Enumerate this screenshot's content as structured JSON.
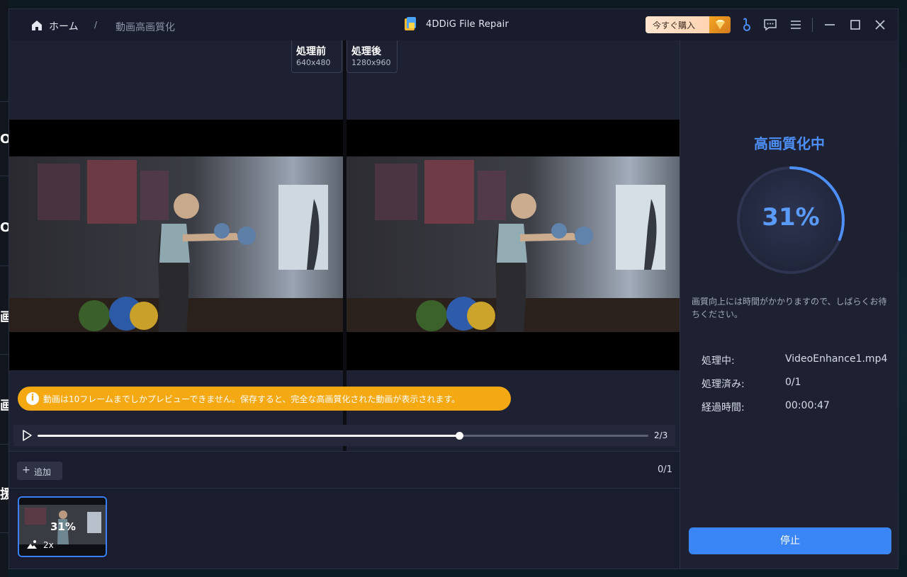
{
  "background": {
    "glyphs": [
      "O",
      "O",
      "画",
      "画",
      "援"
    ]
  },
  "header": {
    "home_label": "ホーム",
    "separator": "/",
    "current_page": "動画高画質化",
    "app_title": "4DDiG File Repair",
    "buy_label": "今すぐ購入",
    "icons": [
      "home-icon",
      "gem-icon",
      "support-icon",
      "feedback-icon",
      "menu-icon",
      "minimize-icon",
      "maximize-icon",
      "close-icon"
    ]
  },
  "preview": {
    "before": {
      "title": "処理前",
      "resolution": "640x480"
    },
    "after": {
      "title": "処理後",
      "resolution": "1280x960"
    },
    "notice": "動画は10フレームまでしかプレビューできません。保存すると、完全な高画質化された動画が表示されます。",
    "player": {
      "progress": 0.69,
      "frame_counter": "2/3"
    }
  },
  "list": {
    "add_label": "追加",
    "count": "0/1",
    "items": [
      {
        "percent": "31%",
        "scale": "2x",
        "progress": 0.31
      }
    ]
  },
  "side": {
    "title": "高画質化中",
    "progress_text": "31%",
    "progress": 0.31,
    "note": "画質向上には時間がかかりますので、しばらくお待ちください。",
    "rows": [
      {
        "key": "処理中:",
        "value": "VideoEnhance1.mp4"
      },
      {
        "key": "処理済み:",
        "value": "0/1"
      },
      {
        "key": "経過時間:",
        "value": "00:00:47"
      }
    ],
    "stop_label": "停止"
  },
  "colors": {
    "accent": "#3b86f7",
    "notice": "#f4a812",
    "panel": "#1e2132"
  }
}
